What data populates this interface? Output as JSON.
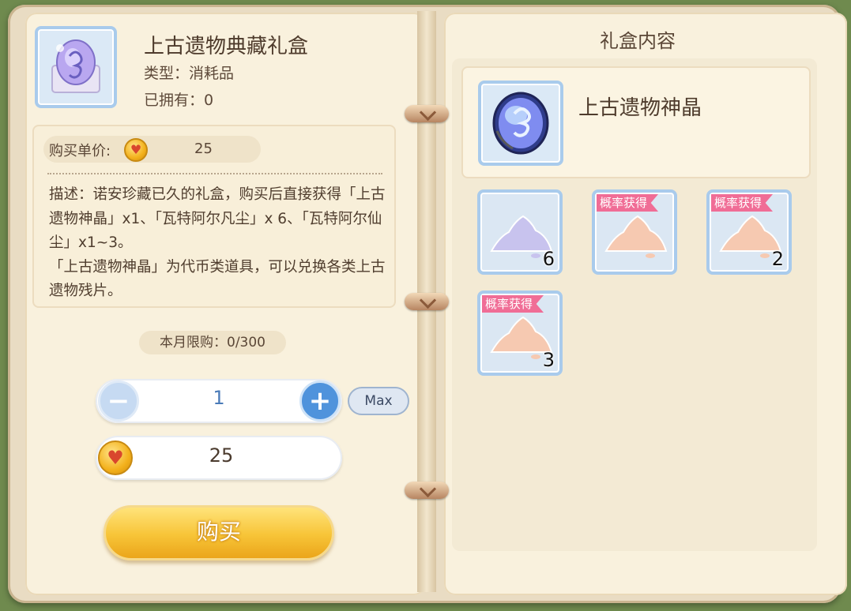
{
  "item": {
    "name": "上古遗物典藏礼盒",
    "type_line": "类型：消耗品",
    "owned_line": "已拥有：0"
  },
  "price": {
    "label": "购买单价:",
    "value": "25",
    "currency_icon": "coin-heart-icon"
  },
  "description": {
    "paragraph1": "描述：诺安珍藏已久的礼盒，购买后直接获得「上古遗物神晶」x1、「瓦特阿尔凡尘」x 6、「瓦特阿尔仙尘」x1~3。",
    "paragraph2": "「上古遗物神晶」为代币类道具，可以兑换各类上古遗物残片。"
  },
  "limit": {
    "text": "本月限购：0/300",
    "used": 0,
    "max": 300
  },
  "quantity": {
    "value": "1",
    "max_label": "Max"
  },
  "total": {
    "value": "25"
  },
  "buy_button": {
    "label": "购买"
  },
  "gift": {
    "title": "礼盒内容",
    "featured_name": "上古遗物神晶",
    "items": [
      {
        "tag": "",
        "qty": "6",
        "tint": "#bcbbe8"
      },
      {
        "tag": "概率获得",
        "qty": "",
        "tint": "#f3c0a8"
      },
      {
        "tag": "概率获得",
        "qty": "2",
        "tint": "#f3c0a8"
      },
      {
        "tag": "概率获得",
        "qty": "3",
        "tint": "#f3c0a8"
      }
    ]
  },
  "colors": {
    "accent_blue": "#4f93dc",
    "buy_yellow": "#f7c437",
    "tag_pink": "#f06d96",
    "paper": "#f9f1dd"
  }
}
